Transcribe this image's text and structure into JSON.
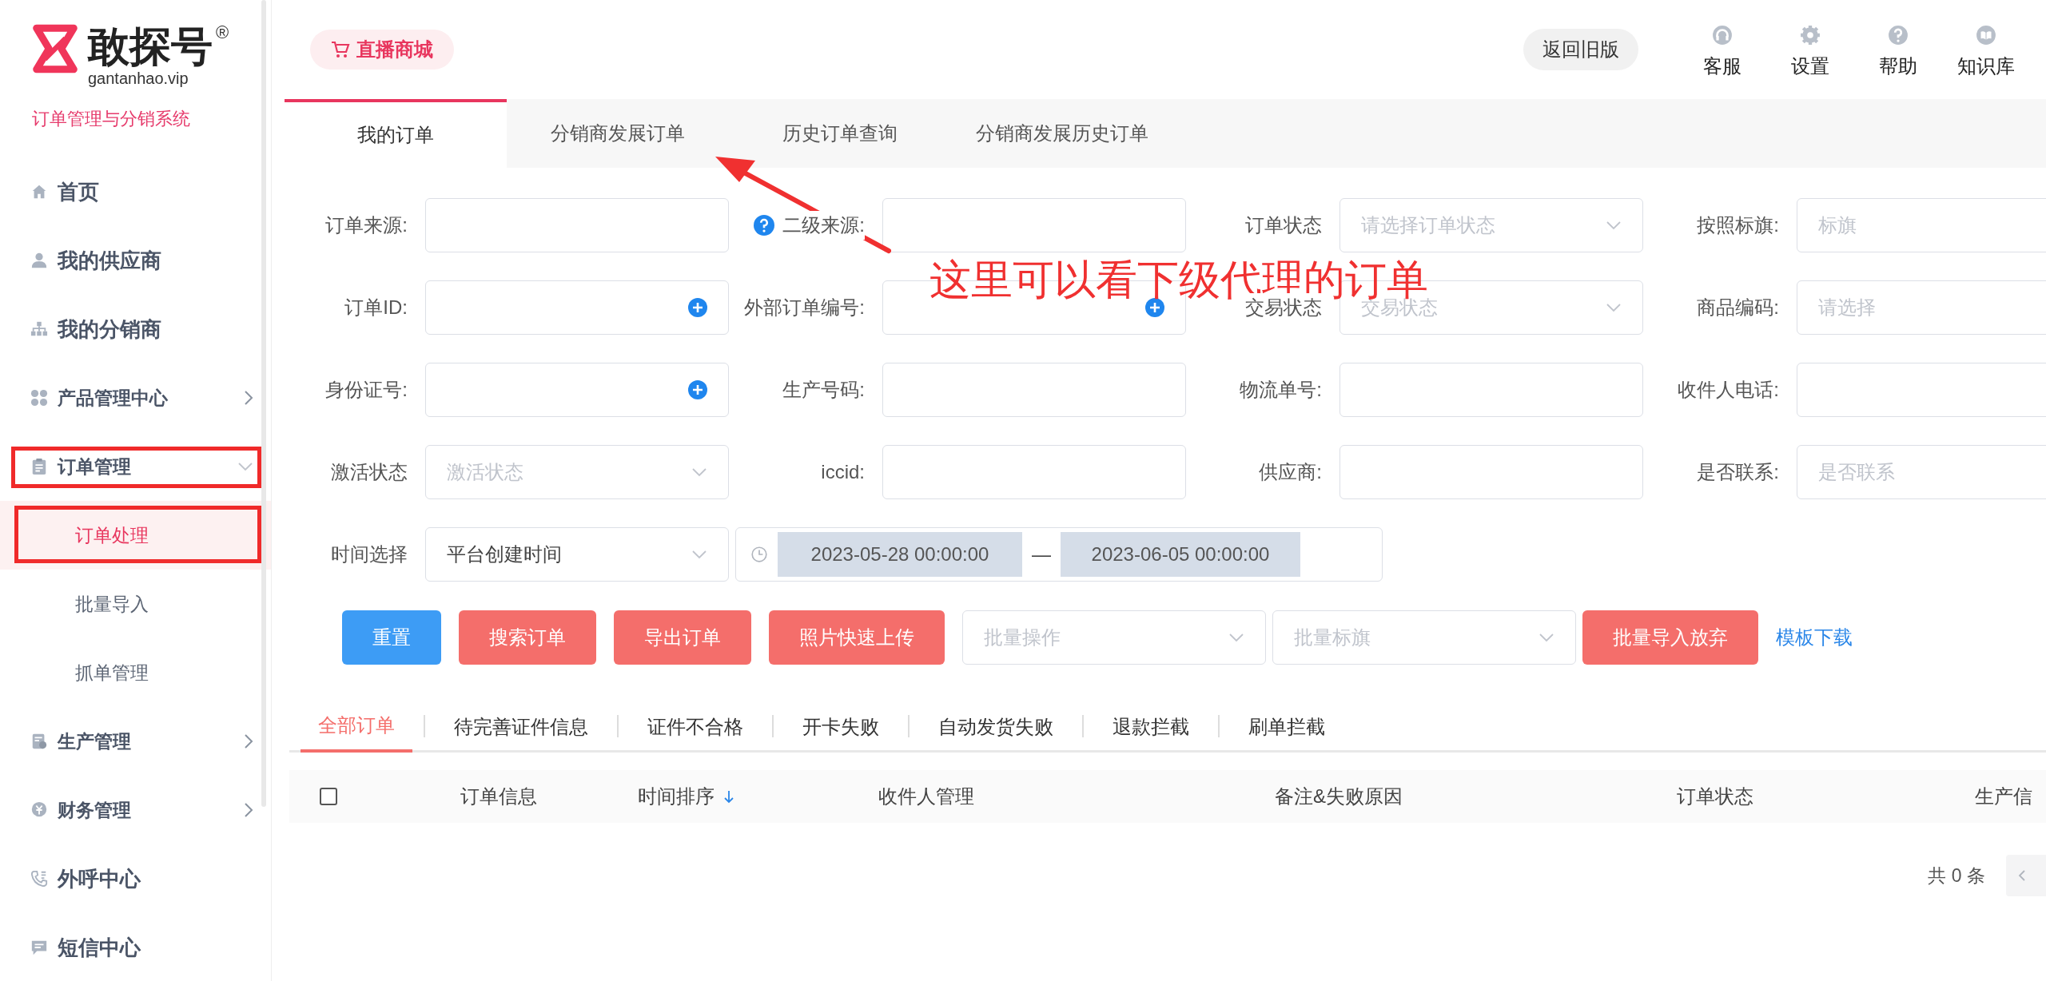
{
  "sidebar": {
    "logo": {
      "name": "敢探号",
      "domain": "gantanhao.vip",
      "mark": "®"
    },
    "subtitle": "订单管理与分销系统",
    "items": [
      {
        "label": "首页",
        "kind": "link"
      },
      {
        "label": "我的供应商",
        "kind": "link"
      },
      {
        "label": "我的分销商",
        "kind": "link"
      },
      {
        "label": "产品管理中心",
        "kind": "group",
        "expanded": false
      },
      {
        "label": "订单管理",
        "kind": "group",
        "expanded": true,
        "annotated": true,
        "children": [
          {
            "label": "订单处理",
            "selected": true,
            "annotated": true
          },
          {
            "label": "批量导入",
            "selected": false,
            "annotated": false
          },
          {
            "label": "抓单管理",
            "selected": false,
            "annotated": false
          }
        ]
      },
      {
        "label": "生产管理",
        "kind": "group",
        "expanded": false
      },
      {
        "label": "财务管理",
        "kind": "group",
        "expanded": false
      },
      {
        "label": "外呼中心",
        "kind": "link"
      },
      {
        "label": "短信中心",
        "kind": "link"
      }
    ]
  },
  "topbar": {
    "mall_button": "直播商城",
    "old_version_button": "返回旧版",
    "tools": [
      {
        "label": "客服"
      },
      {
        "label": "设置"
      },
      {
        "label": "帮助"
      },
      {
        "label": "知识库"
      }
    ]
  },
  "page_tabs": [
    {
      "label": "我的订单",
      "selected": true
    },
    {
      "label": "分销商发展订单",
      "selected": false
    },
    {
      "label": "历史订单查询",
      "selected": false
    },
    {
      "label": "分销商发展历史订单",
      "selected": false
    }
  ],
  "filters": [
    [
      {
        "label": "订单来源:",
        "kind": "text"
      },
      {
        "label": "二级来源:",
        "kind": "text",
        "help": true
      },
      {
        "label": "订单状态",
        "kind": "select",
        "placeholder": "请选择订单状态"
      },
      {
        "label": "按照标旗:",
        "kind": "text",
        "placeholder": "标旗"
      }
    ],
    [
      {
        "label": "订单ID:",
        "kind": "text",
        "add_button": true
      },
      {
        "label": "外部订单编号:",
        "kind": "text",
        "add_button": true
      },
      {
        "label": "交易状态",
        "kind": "select",
        "placeholder": "交易状态"
      },
      {
        "label": "商品编码:",
        "kind": "text",
        "placeholder": "请选择"
      }
    ],
    [
      {
        "label": "身份证号:",
        "kind": "text",
        "add_button": true
      },
      {
        "label": "生产号码:",
        "kind": "text"
      },
      {
        "label": "物流单号:",
        "kind": "text"
      },
      {
        "label": "收件人电话:",
        "kind": "text"
      }
    ],
    [
      {
        "label": "激活状态",
        "kind": "select",
        "placeholder": "激活状态"
      },
      {
        "label": "iccid:",
        "kind": "text"
      },
      {
        "label": "供应商:",
        "kind": "text"
      },
      {
        "label": "是否联系:",
        "kind": "text",
        "placeholder": "是否联系"
      }
    ]
  ],
  "time_filter": {
    "label": "时间选择",
    "value": "平台创建时间",
    "range_start": "2023-05-28 00:00:00",
    "range_separator": "—",
    "range_end": "2023-06-05 00:00:00"
  },
  "actions": [
    {
      "kind": "primary",
      "label": "重置"
    },
    {
      "kind": "danger",
      "label": "搜索订单"
    },
    {
      "kind": "danger",
      "label": "导出订单"
    },
    {
      "kind": "danger",
      "label": "照片快速上传"
    },
    {
      "kind": "select",
      "placeholder": "批量操作"
    },
    {
      "kind": "select",
      "placeholder": "批量标旗"
    },
    {
      "kind": "danger",
      "label": "批量导入放弃"
    },
    {
      "kind": "link",
      "label": "模板下载"
    }
  ],
  "status_tabs": [
    {
      "label": "全部订单",
      "selected": true
    },
    {
      "label": "待完善证件信息",
      "selected": false
    },
    {
      "label": "证件不合格",
      "selected": false
    },
    {
      "label": "开卡失败",
      "selected": false
    },
    {
      "label": "自动发货失败",
      "selected": false
    },
    {
      "label": "退款拦截",
      "selected": false
    },
    {
      "label": "刷单拦截",
      "selected": false
    }
  ],
  "table": {
    "select_all": {
      "checked": false
    },
    "columns": [
      {
        "label": "订单信息",
        "sortable": false
      },
      {
        "label": "时间排序",
        "sortable": true
      },
      {
        "label": "收件人管理",
        "sortable": false
      },
      {
        "label": "备注&失败原因",
        "sortable": false
      },
      {
        "label": "订单状态",
        "sortable": false
      },
      {
        "label": "生产信",
        "sortable": false
      }
    ]
  },
  "pagination": {
    "total": "共 0 条"
  },
  "annotation": {
    "text": "这里可以看下级代理的订单"
  }
}
